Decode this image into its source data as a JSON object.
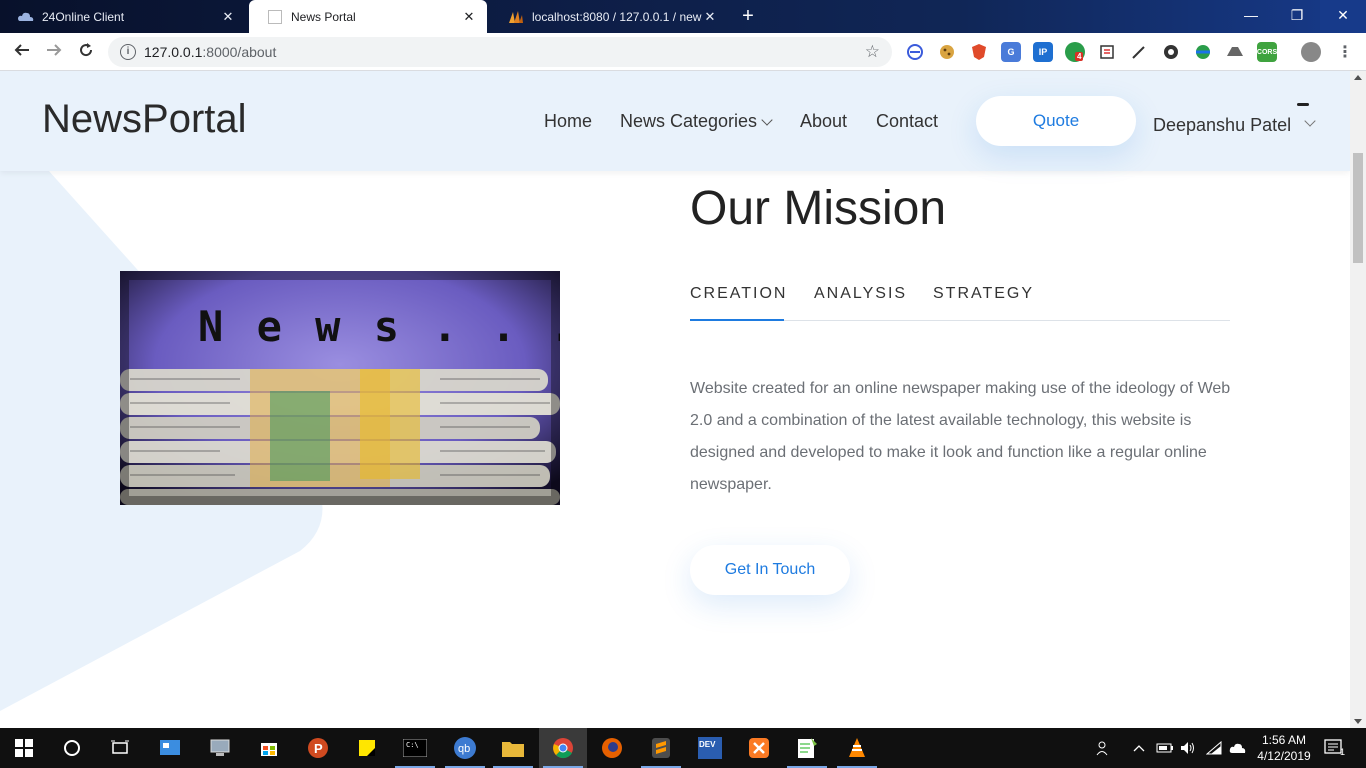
{
  "browser": {
    "tabs": [
      {
        "title": "24Online Client",
        "close": "✕"
      },
      {
        "title": "News Portal",
        "close": "✕"
      },
      {
        "title": "localhost:8080 / 127.0.0.1 / news",
        "close": "✕"
      }
    ],
    "new_tab": "+",
    "window_controls": {
      "minimize": "—",
      "restore": "❐",
      "close": "✕"
    },
    "address": {
      "host": "127.0.0.1",
      "path": ":8000/about"
    },
    "extensions": [
      "edge-sync-icon",
      "cookie-icon",
      "brave-shield-icon",
      "translate-icon",
      "ip-icon",
      "counter-icon",
      "notion-icon",
      "pen-icon",
      "circle-icon",
      "globe-icon",
      "drive-icon",
      "cors-icon",
      "profile-icon",
      "menu-icon"
    ],
    "extension_labels": {
      "ip": "IP",
      "counter_badge": "4",
      "cors": "CORS"
    }
  },
  "site": {
    "logo": "NewsPortal",
    "nav": {
      "home": "Home",
      "categories": "News Categories",
      "about": "About",
      "contact": "Contact"
    },
    "quote_label": "Quote",
    "user_name": "Deepanshu Patel"
  },
  "mission": {
    "title": "Our Mission",
    "tabs": [
      "CREATION",
      "ANALYSIS",
      "STRATEGY"
    ],
    "active_tab": "CREATION",
    "text": "Website created for an online newspaper making use of the ideology of Web 2.0 and a combination of the latest available technology, this website is designed and developed to make it look and function like a regular online newspaper.",
    "cta": "Get In Touch",
    "image_caption": "N e w s . . . ."
  },
  "colors": {
    "accent": "#1e7be0",
    "header_bg": "#e9f2fb",
    "taskbar_bg": "#101010"
  },
  "taskbar": {
    "apps": [
      "start-icon",
      "cortana-icon",
      "task-view-icon",
      "control-panel-icon",
      "computer-icon",
      "store-icon",
      "pj-icon",
      "sticky-notes-icon",
      "terminal-icon",
      "qbittorrent-icon",
      "file-explorer-icon",
      "chrome-icon",
      "firefox-icon",
      "sublime-icon",
      "dev-cpp-icon",
      "xampp-icon",
      "notepad-plus-icon",
      "vlc-icon"
    ],
    "time": "1:56 AM",
    "date": "4/12/2019",
    "notification_count": "1",
    "qb_label": "qb",
    "dev_label": "DEV"
  }
}
